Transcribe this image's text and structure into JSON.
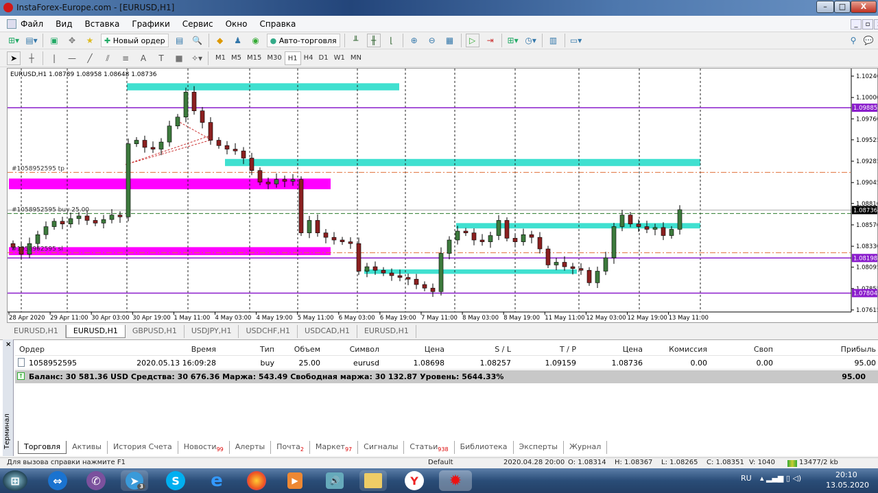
{
  "window": {
    "title": "InstaForex-Europe.com - [EURUSD,H1]",
    "minimize": "–",
    "maximize": "□",
    "close": "X"
  },
  "menu": [
    "Файл",
    "Вид",
    "Вставка",
    "Графики",
    "Сервис",
    "Окно",
    "Справка"
  ],
  "toolbar": {
    "new_order": "Новый ордер",
    "autotrading": "Авто-торговля"
  },
  "timeframes": [
    "M1",
    "M5",
    "M15",
    "M30",
    "H1",
    "H4",
    "D1",
    "W1",
    "MN"
  ],
  "active_timeframe": "H1",
  "chart_header": "EURUSD,H1  1.08789 1.08958 1.08648 1.08736",
  "chart_labels": {
    "tp": "#1058952595 tp",
    "buy": "#1058952595 buy 25.00",
    "sl": "#1058952595 sl"
  },
  "chart_data": {
    "type": "candlestick",
    "symbol": "EURUSD",
    "timeframe": "H1",
    "closes": [
      1.0832,
      1.0824,
      1.0836,
      1.0846,
      1.0855,
      1.0861,
      1.0858,
      1.0864,
      1.0867,
      1.0862,
      1.0859,
      1.0863,
      1.0868,
      1.0866,
      1.0948,
      1.0952,
      1.0944,
      1.0942,
      1.095,
      1.0968,
      1.0978,
      1.1006,
      1.0985,
      1.0972,
      1.0952,
      1.0946,
      1.0942,
      1.094,
      1.0932,
      1.0918,
      1.0905,
      1.0903,
      1.0908,
      1.0906,
      1.0908,
      1.0848,
      1.0862,
      1.0848,
      1.0843,
      1.084,
      1.0838,
      1.0836,
      1.0805,
      1.081,
      1.0806,
      1.0803,
      1.08,
      1.0798,
      1.0796,
      1.079,
      1.0786,
      1.0782,
      1.0825,
      1.084,
      1.085,
      1.0848,
      1.084,
      1.0838,
      1.0845,
      1.0862,
      1.0842,
      1.0838,
      1.0846,
      1.0843,
      1.083,
      1.0812,
      1.0815,
      1.081,
      1.0808,
      1.0806,
      1.0792,
      1.0805,
      1.082,
      1.0855,
      1.0868,
      1.0858,
      1.0855,
      1.0852,
      1.0854,
      1.0845,
      1.0852,
      1.0874
    ],
    "ylim": [
      1.07615,
      1.1024
    ],
    "y_ticks": [
      "1.10240",
      "1.10000",
      "1.09760",
      "1.09525",
      "1.09285",
      "1.09045",
      "1.08810",
      "1.08570",
      "1.08330",
      "1.08095",
      "1.07855",
      "1.07615"
    ],
    "x_ticks": [
      "28 Apr 2020",
      "29 Apr 11:00",
      "30 Apr 03:00",
      "30 Apr 19:00",
      "1 May 11:00",
      "4 May 03:00",
      "4 May 19:00",
      "5 May 11:00",
      "6 May 03:00",
      "6 May 19:00",
      "7 May 11:00",
      "8 May 03:00",
      "8 May 19:00",
      "11 May 11:00",
      "12 May 03:00",
      "12 May 19:00",
      "13 May 11:00"
    ],
    "levels": [
      {
        "price": "1.09885",
        "color": "#8a1ccc"
      },
      {
        "price": "1.08198",
        "color": "#8a1ccc"
      },
      {
        "price": "1.07804",
        "color": "#8a1ccc"
      }
    ],
    "bid": "1.08736",
    "order_lines": {
      "tp": 1.09159,
      "open": 1.08698,
      "sl": 1.08257
    },
    "zones": [
      {
        "color": "#40e0d0",
        "from": 1.1008,
        "to": 1.1016
      },
      {
        "color": "#40e0d0",
        "from": 1.0923,
        "to": 1.0931
      },
      {
        "color": "#ff00ff",
        "from": 1.0897,
        "to": 1.0909
      },
      {
        "color": "#ff00ff",
        "from": 1.0823,
        "to": 1.0832
      },
      {
        "color": "#40e0d0",
        "from": 1.0853,
        "to": 1.0859
      },
      {
        "color": "#40e0d0",
        "from": 1.0802,
        "to": 1.0807
      }
    ]
  },
  "chart_tabs": [
    "EURUSD,H1",
    "EURUSD,H1",
    "GBPUSD,H1",
    "USDJPY,H1",
    "USDCHF,H1",
    "USDCAD,H1",
    "EURUSD,H1"
  ],
  "terminal": {
    "side_label": "Терминал",
    "columns": [
      "Ордер",
      "Время",
      "Тип",
      "Объем",
      "Символ",
      "Цена",
      "S / L",
      "T / P",
      "Цена",
      "Комиссия",
      "Своп",
      "Прибыль"
    ],
    "order": [
      "1058952595",
      "2020.05.13 16:09:28",
      "buy",
      "25.00",
      "eurusd",
      "1.08698",
      "1.08257",
      "1.09159",
      "1.08736",
      "0.00",
      "0.00",
      "95.00"
    ],
    "balance": "Баланс: 30 581.36 USD  Средства: 30 676.36  Маржа: 543.49  Свободная маржа: 30 132.87  Уровень: 5644.33%",
    "total": "95.00",
    "tabs": [
      {
        "label": "Торговля"
      },
      {
        "label": "Активы"
      },
      {
        "label": "История Счета"
      },
      {
        "label": "Новости",
        "badge": "99"
      },
      {
        "label": "Алерты"
      },
      {
        "label": "Почта",
        "badge": "2"
      },
      {
        "label": "Маркет",
        "badge": "97"
      },
      {
        "label": "Сигналы"
      },
      {
        "label": "Статьи",
        "badge": "938"
      },
      {
        "label": "Библиотека"
      },
      {
        "label": "Эксперты"
      },
      {
        "label": "Журнал"
      }
    ]
  },
  "status": {
    "help": "Для вызова справки нажмите F1",
    "profile": "Default",
    "time": "2020.04.28 20:00",
    "o": "O: 1.08314",
    "h": "H: 1.08367",
    "l": "L: 1.08265",
    "c": "C: 1.08351",
    "v": "V: 1040",
    "traffic": "13477/2 kb"
  },
  "tray": {
    "lang": "RU",
    "clock": "20:10",
    "date": "13.05.2020"
  },
  "taskbar_badge": "3"
}
